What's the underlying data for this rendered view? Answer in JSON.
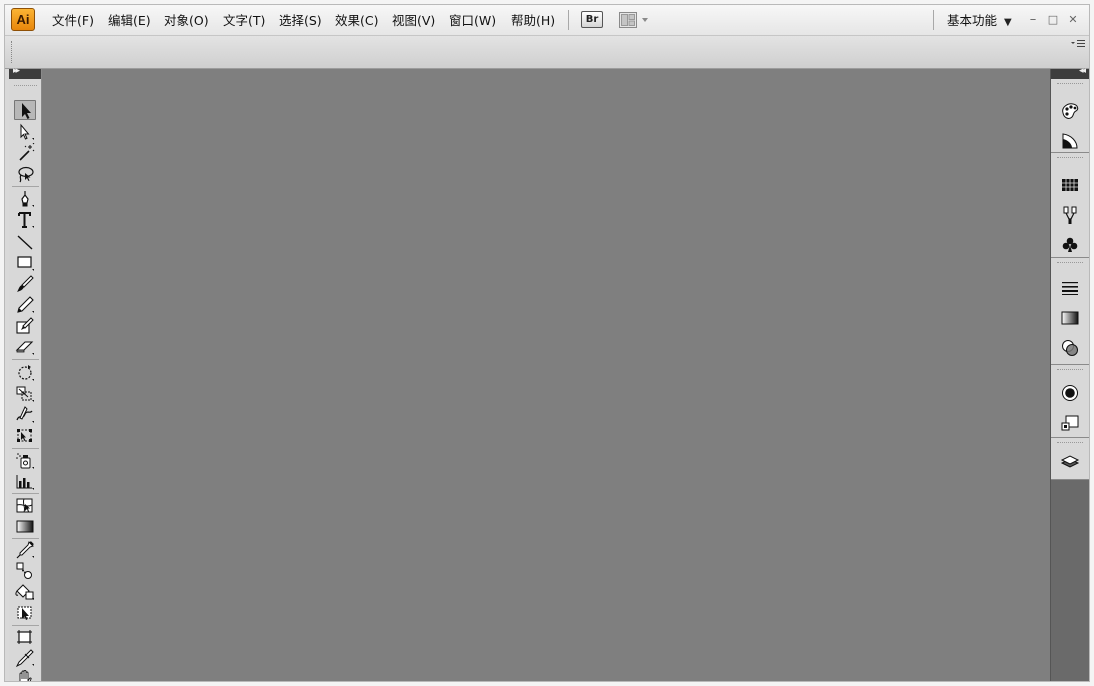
{
  "app": {
    "logo_text": "Ai",
    "accent_color": "#f2a31e"
  },
  "menubar": {
    "items": [
      {
        "label": "文件(F)",
        "name": "menu-file"
      },
      {
        "label": "编辑(E)",
        "name": "menu-edit"
      },
      {
        "label": "对象(O)",
        "name": "menu-object"
      },
      {
        "label": "文字(T)",
        "name": "menu-type"
      },
      {
        "label": "选择(S)",
        "name": "menu-select"
      },
      {
        "label": "效果(C)",
        "name": "menu-effect"
      },
      {
        "label": "视图(V)",
        "name": "menu-view"
      },
      {
        "label": "窗口(W)",
        "name": "menu-window"
      },
      {
        "label": "帮助(H)",
        "name": "menu-help"
      }
    ],
    "bridge_label": "Br",
    "workspace_label": "基本功能",
    "workspace_arrow": "▼",
    "minimize": "–",
    "maximize": "□",
    "close": "✕"
  },
  "toolbar_icons": [
    "selection-tool-icon",
    "direct-selection-tool-icon",
    "magic-wand-tool-icon",
    "lasso-tool-icon",
    "pen-tool-icon",
    "type-tool-icon",
    "line-segment-tool-icon",
    "rectangle-tool-icon",
    "paintbrush-tool-icon",
    "pencil-tool-icon",
    "blob-brush-tool-icon",
    "eraser-tool-icon",
    "rotate-tool-icon",
    "scale-tool-icon",
    "warp-tool-icon",
    "free-transform-tool-icon",
    "symbol-sprayer-tool-icon",
    "column-graph-tool-icon",
    "mesh-tool-icon",
    "gradient-tool-icon",
    "eyedropper-tool-icon",
    "blend-tool-icon",
    "live-paint-bucket-tool-icon",
    "live-paint-selection-tool-icon",
    "artboard-tool-icon",
    "slice-tool-icon",
    "hand-tool-icon"
  ],
  "dock_icons": [
    "color-panel-icon",
    "color-guide-icon",
    "swatches-icon",
    "brushes-icon",
    "symbols-icon",
    "stroke-icon",
    "gradient-panel-icon",
    "transparency-icon",
    "appearance-icon",
    "graphic-styles-icon",
    "layers-icon"
  ],
  "canvas_color": "#7f7f7f"
}
